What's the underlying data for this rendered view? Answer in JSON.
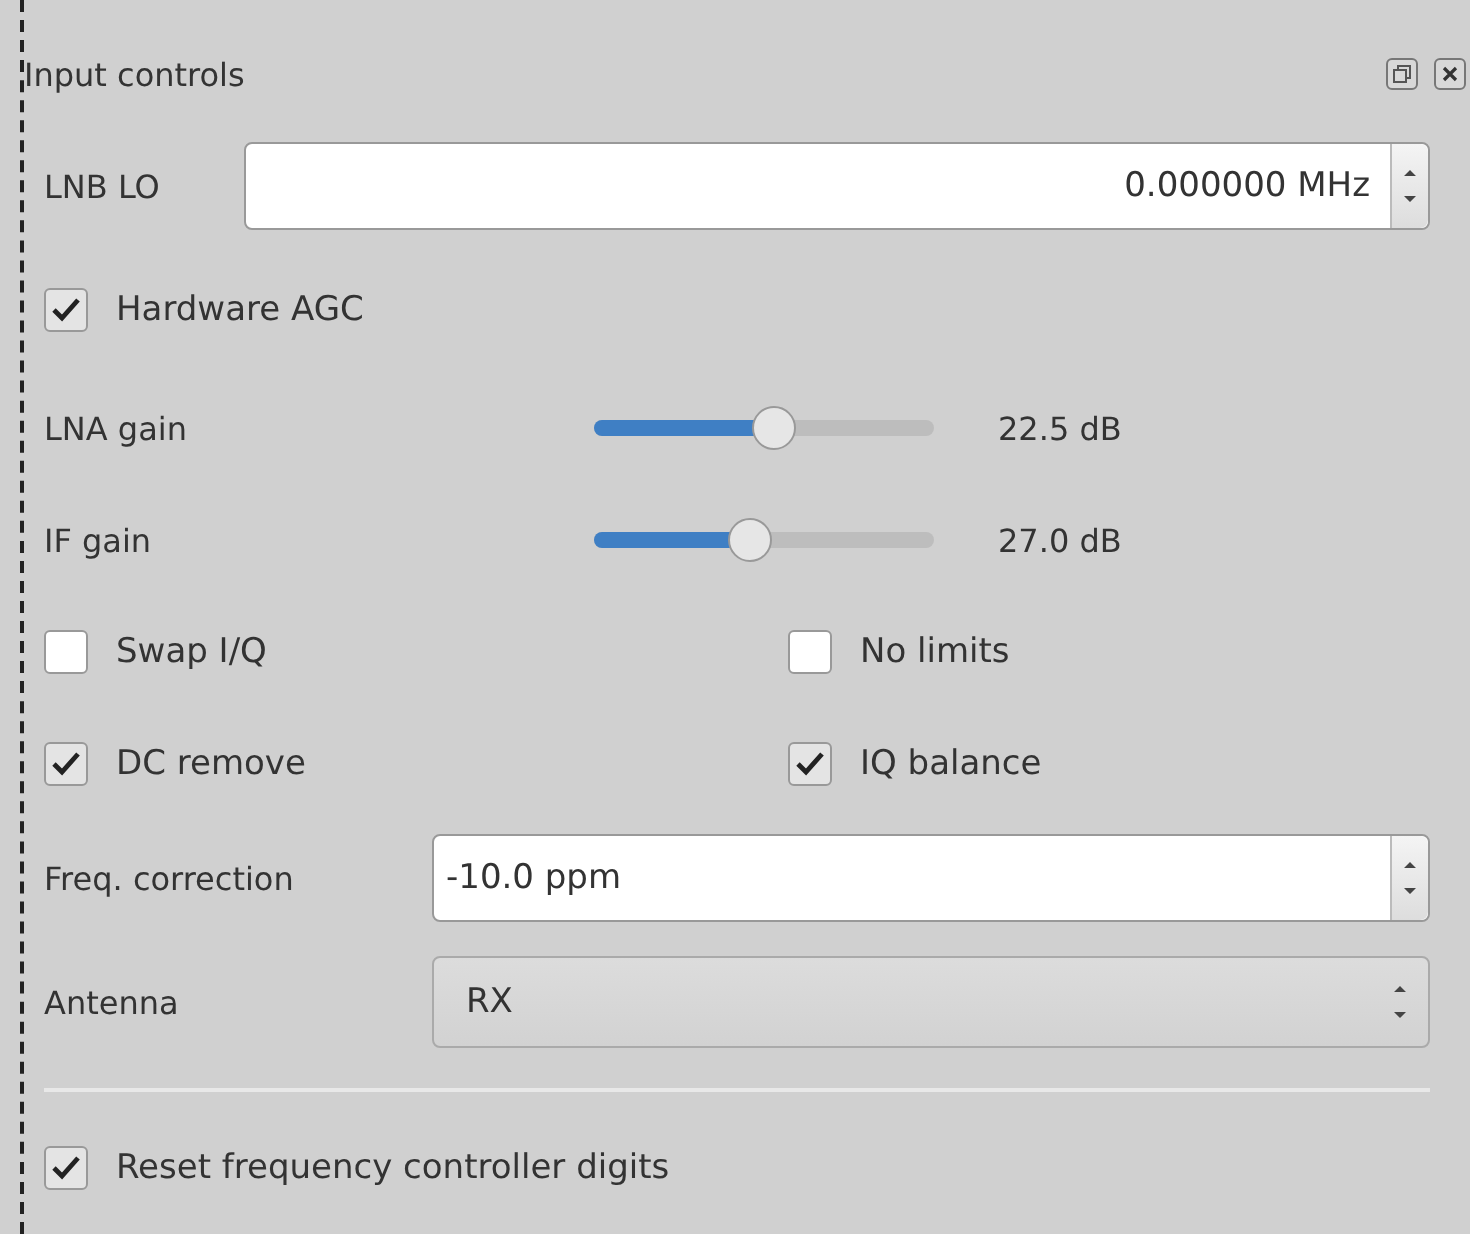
{
  "panel": {
    "title": "Input controls"
  },
  "lnb": {
    "label": "LNB LO",
    "value": "0.000000 MHz"
  },
  "hardware_agc": {
    "label": "Hardware AGC",
    "checked": true
  },
  "gains": [
    {
      "label": "LNA gain",
      "level": 0.53,
      "reading": "22.5 dB"
    },
    {
      "label": "IF gain",
      "level": 0.46,
      "reading": "27.0 dB"
    }
  ],
  "options": [
    {
      "label": "Swap I/Q",
      "checked": false
    },
    {
      "label": "No limits",
      "checked": false
    },
    {
      "label": "DC remove",
      "checked": true
    },
    {
      "label": "IQ balance",
      "checked": true
    }
  ],
  "freq_correction": {
    "label": "Freq. correction",
    "value": "-10.0 ppm"
  },
  "antenna": {
    "label": "Antenna",
    "value": "RX"
  },
  "reset_digits": {
    "label": "Reset frequency controller digits",
    "checked": true
  }
}
